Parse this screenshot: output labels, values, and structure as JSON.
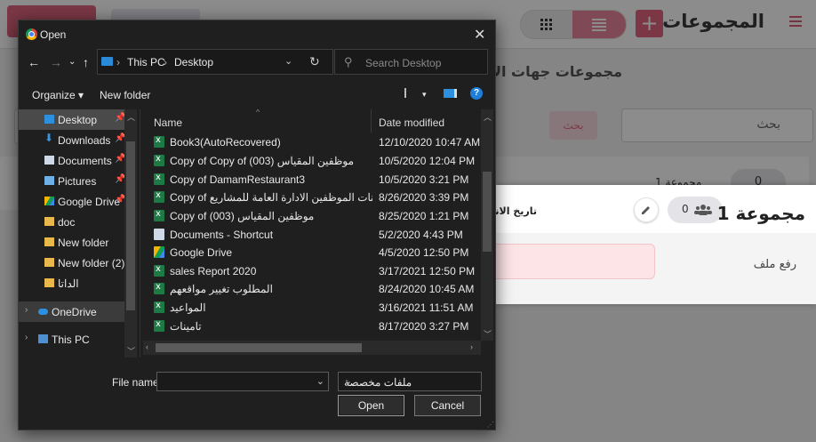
{
  "app": {
    "title": "المجموعات",
    "subtitle": "مجموعات جهات الا",
    "search_placeholder": "بحث",
    "search_button": "بحث",
    "back_card": {
      "count": "0",
      "name": "مجموعة 1"
    },
    "card": {
      "title": "مجموعة 1",
      "members_count": "0",
      "date_label": "تاريخ الانشاء",
      "upload_label": "رفع ملف"
    },
    "colors": {
      "accent": "#e0647e",
      "accent_light": "#e8889b"
    }
  },
  "dialog": {
    "title": "Open",
    "address": {
      "root": "This PC",
      "folder": "Desktop"
    },
    "search_placeholder": "Search Desktop",
    "toolbar": {
      "organize": "Organize",
      "new_folder": "New folder"
    },
    "columns": {
      "name": "Name",
      "date_modified": "Date modified"
    },
    "nav_items": [
      {
        "label": "Desktop",
        "icon": "desktop-folder-icon",
        "pinned": true
      },
      {
        "label": "Downloads",
        "icon": "download-icon",
        "pinned": true
      },
      {
        "label": "Documents",
        "icon": "document-icon",
        "pinned": true
      },
      {
        "label": "Pictures",
        "icon": "pictures-icon",
        "pinned": true
      },
      {
        "label": "Google Drive",
        "icon": "google-drive-icon",
        "pinned": true
      },
      {
        "label": "doc",
        "icon": "folder-icon",
        "pinned": false
      },
      {
        "label": "New folder",
        "icon": "folder-icon",
        "pinned": false
      },
      {
        "label": "New folder (2)",
        "icon": "folder-icon",
        "pinned": false
      },
      {
        "label": "الداتا",
        "icon": "folder-icon",
        "pinned": false
      },
      {
        "label": "OneDrive",
        "icon": "onedrive-icon",
        "pinned": false
      },
      {
        "label": "This PC",
        "icon": "this-pc-icon",
        "pinned": false
      }
    ],
    "files": [
      {
        "name": "Book3(AutoRecovered)",
        "date": "12/10/2020 10:47 AM",
        "icon": "excel-file-icon"
      },
      {
        "name": "Copy of Copy of موظفين المقياس (003)",
        "date": "10/5/2020 12:04 PM",
        "icon": "excel-file-icon"
      },
      {
        "name": "Copy of DamamRestaurant3",
        "date": "10/5/2020 3:21 PM",
        "icon": "excel-file-icon"
      },
      {
        "name": "Copy of بيانات الموظفين الادارة العامة للمشاريع ...",
        "date": "8/26/2020 3:39 PM",
        "icon": "excel-file-icon"
      },
      {
        "name": "Copy of موظفين المقياس (003)",
        "date": "8/25/2020 1:21 PM",
        "icon": "excel-file-icon"
      },
      {
        "name": "Documents - Shortcut",
        "date": "5/2/2020 4:43 PM",
        "icon": "shortcut-icon"
      },
      {
        "name": "Google Drive",
        "date": "4/5/2020 12:50 PM",
        "icon": "google-drive-icon"
      },
      {
        "name": "sales Report 2020",
        "date": "3/17/2021 12:50 PM",
        "icon": "excel-file-icon"
      },
      {
        "name": "المطلوب تغيير مواقعهم",
        "date": "8/24/2020 10:45 AM",
        "icon": "excel-file-icon"
      },
      {
        "name": "المواعيد",
        "date": "3/16/2021 11:51 AM",
        "icon": "excel-file-icon"
      },
      {
        "name": "تامينات",
        "date": "8/17/2020 3:27 PM",
        "icon": "excel-file-icon"
      }
    ],
    "file_name_label": "File name:",
    "file_name_value": "",
    "file_type": "ملفات مخصصة",
    "open_button": "Open",
    "cancel_button": "Cancel"
  }
}
